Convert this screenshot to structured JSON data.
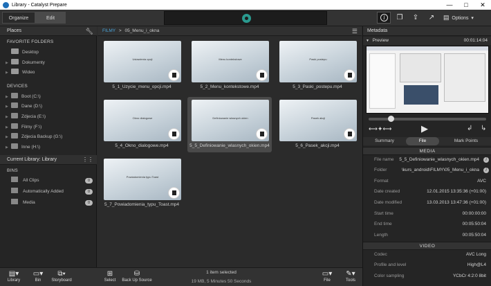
{
  "window": {
    "title": "Library - Catalyst Prepare",
    "min": "—",
    "max": "□",
    "close": "✕"
  },
  "toolbar": {
    "organize": "Organize",
    "edit": "Edit",
    "options": "Options"
  },
  "places": {
    "header": "Places",
    "favorites_title": "FAVORITE FOLDERS",
    "favorites": [
      "Desktop",
      "Dokumenty",
      "Wideo"
    ],
    "devices_title": "DEVICES",
    "devices": [
      "Boot (C:\\)",
      "Dane (D:\\)",
      "Zdjecia (E:\\)",
      "Filmy (F:\\)",
      "Zdjecia Backup (G:\\)",
      "Inne (H:\\)"
    ]
  },
  "library": {
    "header": "Current Library: Library",
    "bins_title": "BINS",
    "bins": [
      {
        "label": "All Clips",
        "count": "0"
      },
      {
        "label": "Automatically Added",
        "count": "0"
      },
      {
        "label": "Media",
        "count": "0"
      }
    ]
  },
  "breadcrumb": {
    "root": "FILMY",
    "sep": ">",
    "folder": "05_Menu_i_okna"
  },
  "clips": [
    {
      "thumb_text": "Ustawienia opcji",
      "name": "5_1_Uzycie_menu_opcji.mp4"
    },
    {
      "thumb_text": "Menu kontekstowe",
      "name": "5_2_Menu_kontekstowe.mp4"
    },
    {
      "thumb_text": "Paski postepu",
      "name": "5_3_Paski_postepu.mp4"
    },
    {
      "thumb_text": "Okno dialogowe",
      "name": "5_4_Okno_dialogowe.mp4"
    },
    {
      "thumb_text": "Definiowanie wlasnych okien",
      "name": "5_5_Definiowanie_wlasnych_okien.mp4"
    },
    {
      "thumb_text": "Pasek akcji",
      "name": "5_6_Pasek_akcji.mp4"
    },
    {
      "thumb_text": "Powiadomienia typu Toast",
      "name": "5_7_Powiadomienia_typu_Toast.mp4"
    }
  ],
  "metadata": {
    "header": "Metadata",
    "preview_label": "Preview",
    "timecode": "00:01:14:04",
    "tabs": [
      "Summary",
      "File",
      "Mark Points"
    ],
    "media_title": "MEDIA",
    "video_title": "VIDEO",
    "media_rows": [
      {
        "k": "File name",
        "v": "5_5_Definiowanie_wlasnych_okien.mp4"
      },
      {
        "k": "Folder",
        "v": "\\kurs_android\\FILMY\\05_Menu_i_okna"
      },
      {
        "k": "Format",
        "v": "AVC"
      },
      {
        "k": "Date created",
        "v": "12.01.2015 13:35:36 (+01:00)"
      },
      {
        "k": "Date modified",
        "v": "13.03.2013 13:47:36 (+01:00)"
      },
      {
        "k": "Start time",
        "v": "00:00:00:00"
      },
      {
        "k": "End time",
        "v": "00:05:50:04"
      },
      {
        "k": "Length",
        "v": "00:05:50:04"
      }
    ],
    "video_rows": [
      {
        "k": "Codec",
        "v": "AVC Long"
      },
      {
        "k": "Profile and level",
        "v": "High@L4"
      },
      {
        "k": "Color sampling",
        "v": "YCbCr 4:2:0 8bit"
      }
    ]
  },
  "bottombar": {
    "library": "Library",
    "bin": "Bin",
    "storyboard": "Storyboard",
    "select": "Select",
    "backup": "Back Up Source",
    "file": "File",
    "tools": "Tools",
    "status1": "1 item selected",
    "status2": "19 MB, 5 Minutes 50 Seconds"
  }
}
